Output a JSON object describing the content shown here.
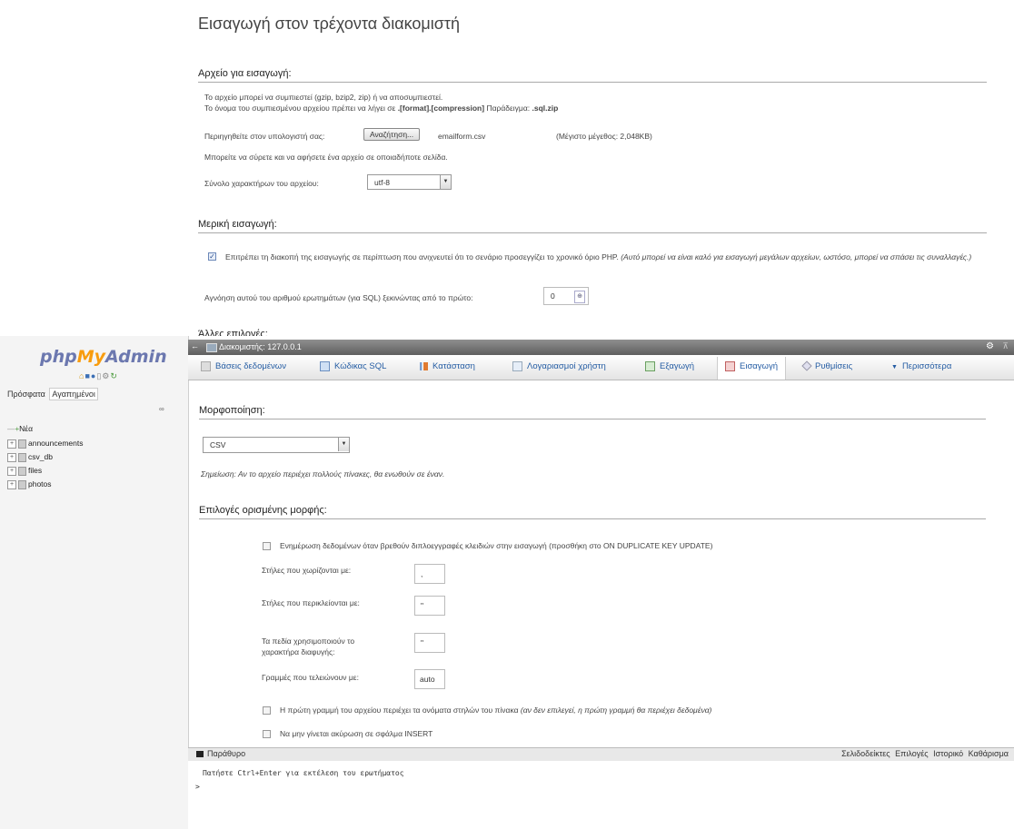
{
  "top_page": {
    "title": "Εισαγωγή στον τρέχοντα διακομιστή",
    "file_section": {
      "heading": "Αρχείο για εισαγωγή:",
      "line1": "Το αρχείο μπορεί να συμπιεστεί (gzip, bzip2, zip) ή να αποσυμπιεστεί.",
      "line2_pre": "Το όνομα του συμπιεσμένου αρχείου πρέπει να λήγει σε",
      "line2_format": ".[format].[compression]",
      "line2_mid": "Παράδειγμα:",
      "line2_example": ".sql.zip",
      "browse_label": "Περιηγηθείτε στον υπολογιστή σας:",
      "browse_button": "Αναζήτηση...",
      "filename": "emailform.csv",
      "max_size": "(Μέγιστο μέγεθος: 2,048KB)",
      "drag_hint": "Μπορείτε να σύρετε και να αφήσετε ένα αρχείο σε οποιαδήποτε σελίδα.",
      "charset_label": "Σύνολο χαρακτήρων του αρχείου:",
      "charset_value": "utf-8"
    },
    "partial_section": {
      "heading": "Μερική εισαγωγή:",
      "allow_interrupt_text": "Επιτρέπει τη διακοπή της εισαγωγής σε περίπτωση που ανιχνευτεί ότι το σενάριο προσεγγίζει το χρονικό όριο PHP.",
      "allow_interrupt_note": "(Αυτό μπορεί να είναι καλό για εισαγωγή μεγάλων αρχείων, ωστόσο, μπορεί να σπάσει τις συναλλαγές.)",
      "allow_interrupt_checked": true,
      "skip_label": "Αγνόηση αυτού του αριθμού ερωτημάτων (για SQL) ξεκινώντας από το πρώτο:",
      "skip_value": "0"
    },
    "cut_heading": "Άλλες επιλογές:"
  },
  "nav": {
    "logo_php": "php",
    "logo_my": "My",
    "logo_admin": "Admin",
    "tab_recent": "Πρόσφατα",
    "tab_favorites": "Αγαπημένοι",
    "items": [
      "Νέα",
      "announcements",
      "csv_db",
      "files",
      "photos"
    ]
  },
  "server_bar": {
    "label": "Διακομιστής: 127.0.0.1"
  },
  "tabs": [
    {
      "label": "Βάσεις δεδομένων"
    },
    {
      "label": "Κώδικας SQL"
    },
    {
      "label": "Κατάσταση"
    },
    {
      "label": "Λογαριασμοί χρήστη"
    },
    {
      "label": "Εξαγωγή"
    },
    {
      "label": "Εισαγωγή"
    },
    {
      "label": "Ρυθμίσεις"
    },
    {
      "label": "Περισσότερα"
    }
  ],
  "format_section": {
    "heading": "Μορφοποίηση:",
    "format_value": "CSV",
    "note_prefix": "Σημείωση:",
    "note_text": "Αν το αρχείο περιέχει πολλούς πίνακες, θα ενωθούν σε έναν."
  },
  "options_section": {
    "heading": "Επιλογές ορισμένης μορφής:",
    "update_dup": "Ενημέρωση δεδομένων όταν βρεθούν διπλοεγγραφές κλειδιών στην εισαγωγή (προσθήκη στο ON DUPLICATE KEY UPDATE)",
    "sep_label": "Στήλες που χωρίζονται με:",
    "sep_value": ",",
    "enclosed_label": "Στήλες που περικλείονται με:",
    "enclosed_value": "\"",
    "escape_label_1": "Τα πεδία χρησιμοποιούν το",
    "escape_label_2": "χαρακτήρα διαφυγής:",
    "escape_value": "\"",
    "lines_label": "Γραμμές που τελειώνουν με:",
    "lines_value": "auto",
    "first_line_text": "Η πρώτη γραμμή του αρχείου περιέχει τα ονόματα στηλών του πίνακα",
    "first_line_note": "(αν δεν επιλεγεί, η πρώτη γραμμή θα περιέχει δεδομένα)",
    "no_abort": "Να μην γίνεται ακύρωση σε σφάλμα INSERT"
  },
  "console": {
    "title": "Παράθυρο",
    "links": [
      "Σελιδοδείκτες",
      "Επιλογές",
      "Ιστορικό",
      "Καθάρισμα"
    ],
    "hint": "Πατήστε Ctrl+Enter για εκτέλεση του ερωτήματος",
    "prompt": ">"
  }
}
